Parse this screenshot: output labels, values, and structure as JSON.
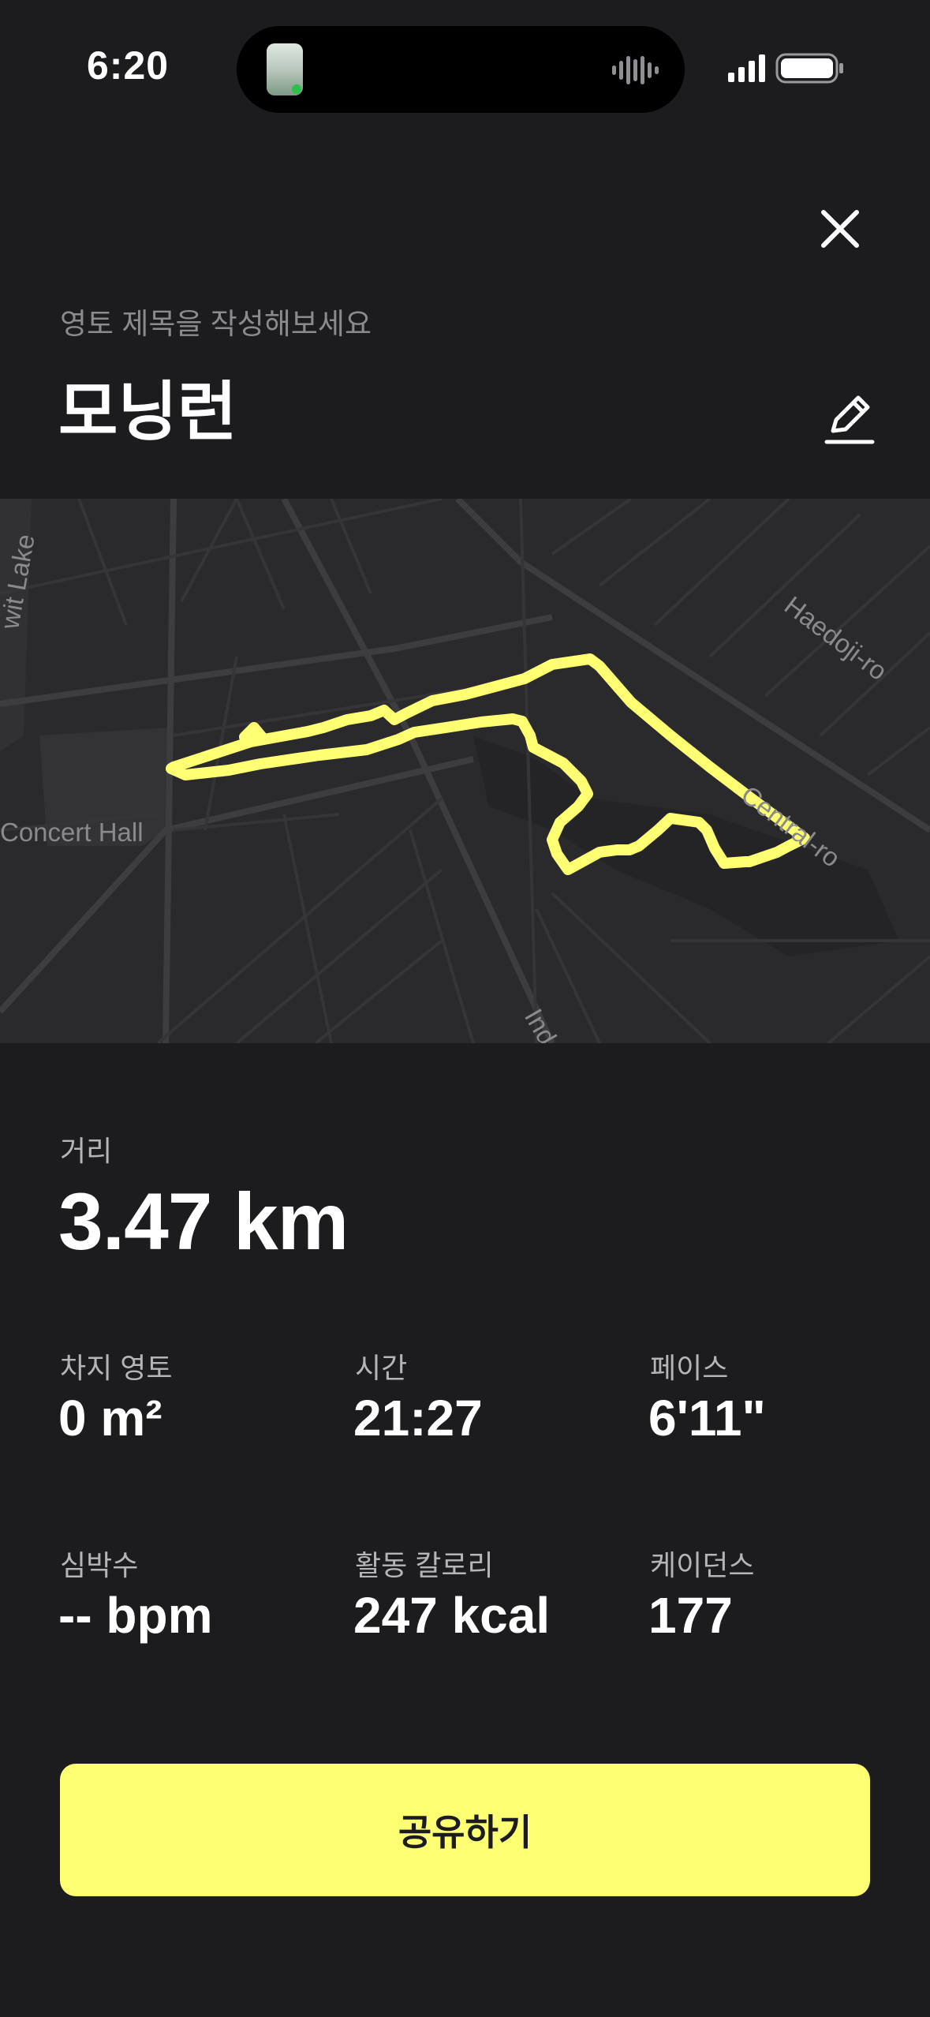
{
  "status_bar": {
    "time": "6:20"
  },
  "header": {
    "title_hint": "영토 제목을 작성해보세요",
    "title": "모닝런"
  },
  "map": {
    "labels": {
      "haedoji": "Haedoji-ro",
      "central": "Central-ro",
      "concert_hall": "Concert Hall",
      "lake": "wit Lake",
      "ind": "Ind"
    },
    "route_color": "#ffff73"
  },
  "distance": {
    "label": "거리",
    "value": "3.47 km"
  },
  "stats": [
    {
      "label": "차지 영토",
      "value": "0 m²"
    },
    {
      "label": "시간",
      "value": "21:27"
    },
    {
      "label": "페이스",
      "value": "6'11\""
    },
    {
      "label": "심박수",
      "value": "-- bpm"
    },
    {
      "label": "활동 칼로리",
      "value": "247 kcal"
    },
    {
      "label": "케이던스",
      "value": "177"
    }
  ],
  "share_button": {
    "label": "공유하기"
  },
  "colors": {
    "background": "#1c1c1e",
    "accent": "#ffff73"
  },
  "icons": {
    "close": "close-icon",
    "edit": "pencil-icon"
  }
}
